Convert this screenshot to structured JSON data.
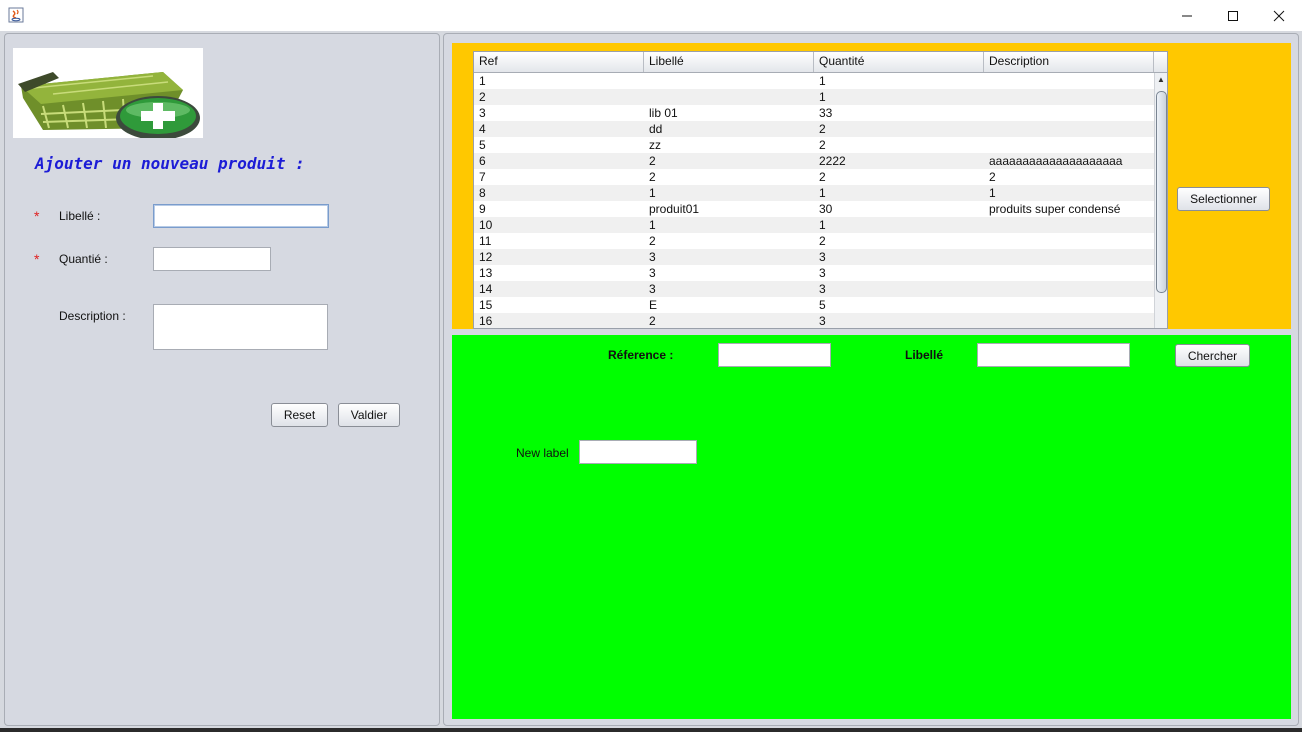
{
  "window": {
    "title": ""
  },
  "left": {
    "image_label": "shopping-basket-add-icon",
    "title": "Ajouter un nouveau produit :",
    "required_mark": "*",
    "libelle_label": "Libellé :",
    "quantite_label": "Quantié :",
    "description_label": "Description :",
    "libelle_value": "",
    "quantite_value": "",
    "description_value": "",
    "reset_label": "Reset",
    "valider_label": "Valdier"
  },
  "table": {
    "columns": [
      "Ref",
      "Libellé",
      "Quantité",
      "Description"
    ],
    "rows": [
      [
        "1",
        "",
        "1",
        ""
      ],
      [
        "2",
        "",
        "1",
        ""
      ],
      [
        "3",
        "lib 01",
        "33",
        ""
      ],
      [
        "4",
        "dd",
        "2",
        ""
      ],
      [
        "5",
        "zz",
        "2",
        ""
      ],
      [
        "6",
        "2",
        "2222",
        "aaaaaaaaaaaaaaaaaaaa"
      ],
      [
        "7",
        "2",
        "2",
        "2"
      ],
      [
        "8",
        "1",
        "1",
        "1"
      ],
      [
        "9",
        "produit01",
        "30",
        "produits super condensé"
      ],
      [
        "10",
        "1",
        "1",
        ""
      ],
      [
        "11",
        "2",
        "2",
        ""
      ],
      [
        "12",
        "3",
        "3",
        ""
      ],
      [
        "13",
        "3",
        "3",
        ""
      ],
      [
        "14",
        "3",
        "3",
        ""
      ],
      [
        "15",
        "E",
        "5",
        ""
      ],
      [
        "16",
        "2",
        "3",
        ""
      ]
    ],
    "selectionner_label": "Selectionner"
  },
  "search": {
    "reference_label": "Réference :",
    "libelle_label": "Libellé",
    "reference_value": "",
    "libelle_value": "",
    "chercher_label": "Chercher",
    "new_label_text": "New label",
    "new_label_value": ""
  },
  "colors": {
    "yellow_panel": "#ffc800",
    "green_panel": "#00ff00",
    "title_blue": "#1c1cd6",
    "required_red": "#e02020"
  }
}
